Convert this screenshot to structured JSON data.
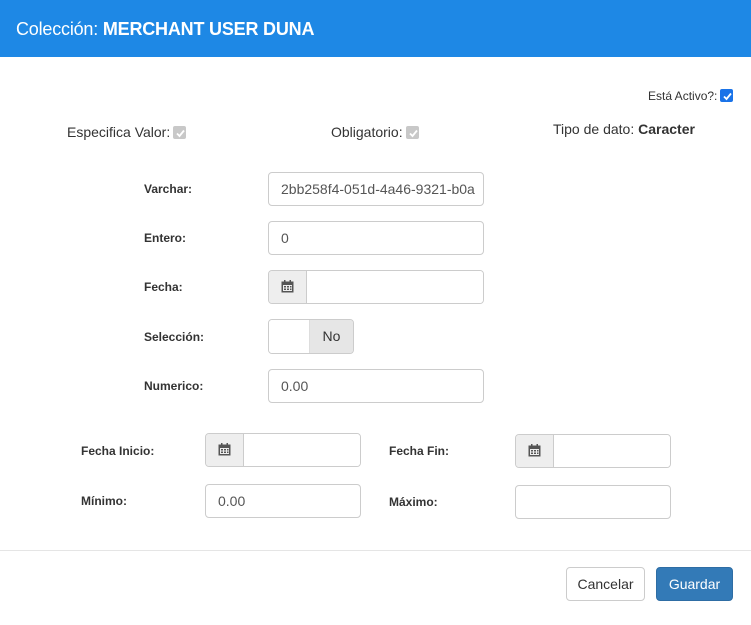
{
  "header": {
    "prefix": "Colección:",
    "collection_name": "MERCHANT USER DUNA"
  },
  "status": {
    "active_label": "Está Activo?:",
    "active_checked": true
  },
  "meta": {
    "specifies_value_label": "Especifica Valor:",
    "specifies_value_checked": true,
    "required_label": "Obligatorio:",
    "required_checked": true,
    "data_type_label": "Tipo de dato:",
    "data_type_value": "Caracter"
  },
  "fields": {
    "varchar": {
      "label": "Varchar:",
      "value": "2bb258f4-051d-4a46-9321-b0a"
    },
    "entero": {
      "label": "Entero:",
      "value": "0"
    },
    "fecha": {
      "label": "Fecha:",
      "value": "",
      "icon": "calendar-icon"
    },
    "seleccion": {
      "label": "Selección:",
      "toggle_text": "No",
      "on": false
    },
    "numerico": {
      "label": "Numerico:",
      "value": "0.00"
    }
  },
  "range": {
    "fecha_inicio": {
      "label": "Fecha Inicio:",
      "value": "",
      "icon": "calendar-icon"
    },
    "fecha_fin": {
      "label": "Fecha Fin:",
      "value": "",
      "icon": "calendar-icon"
    },
    "minimo": {
      "label": "Mínimo:",
      "value": "0.00"
    },
    "maximo": {
      "label": "Máximo:",
      "value": ""
    }
  },
  "footer": {
    "cancel_label": "Cancelar",
    "save_label": "Guardar"
  },
  "colors": {
    "header_bg": "#1e88e5",
    "primary_button": "#337ab7",
    "checkbox_active": "#1a73e8",
    "checkbox_disabled": "#c8c8c8"
  }
}
